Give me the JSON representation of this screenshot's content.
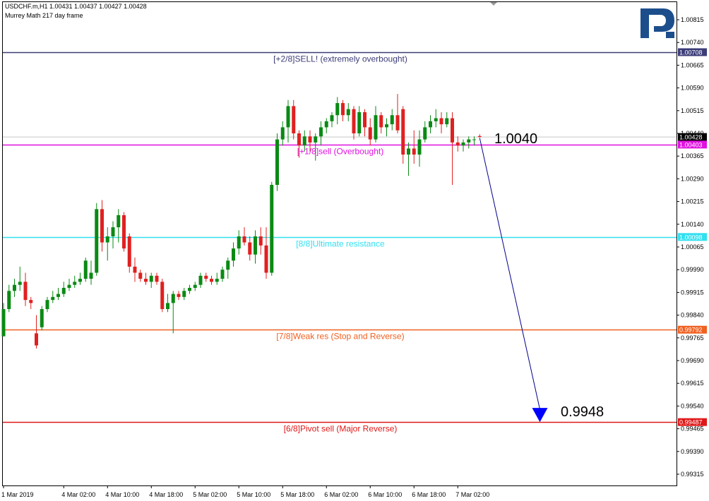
{
  "header": {
    "symbol_line": "USDCHF.m,H1  1.00431 1.00437 1.00427 1.00428",
    "indicator_line": "Murrey Math 217 day frame"
  },
  "logo": {
    "name": "R-logo",
    "color": "#1d4e8c"
  },
  "colors": {
    "up": "#0a8a14",
    "down": "#e02020",
    "arrow": "#00008b",
    "grid": "#000000"
  },
  "chart_data": {
    "type": "candlestick",
    "symbol": "USDCHF.m",
    "timeframe": "H1",
    "ylim": [
      0.9926,
      1.0088
    ],
    "y_ticks": [
      "1.00815",
      "1.00740",
      "1.00665",
      "1.00590",
      "1.00515",
      "1.00440",
      "1.00365",
      "1.00290",
      "1.00215",
      "1.00140",
      "1.00065",
      "0.99990",
      "0.99915",
      "0.99840",
      "0.99765",
      "0.99690",
      "0.99615",
      "0.99540",
      "0.99465",
      "0.99390",
      "0.99315"
    ],
    "x_ticks": [
      {
        "label": "1 Mar 2019",
        "i": 0
      },
      {
        "label": "4 Mar 02:00",
        "i": 11
      },
      {
        "label": "4 Mar 10:00",
        "i": 19
      },
      {
        "label": "4 Mar 18:00",
        "i": 27
      },
      {
        "label": "5 Mar 02:00",
        "i": 35
      },
      {
        "label": "5 Mar 10:00",
        "i": 43
      },
      {
        "label": "5 Mar 18:00",
        "i": 51
      },
      {
        "label": "6 Mar 02:00",
        "i": 59
      },
      {
        "label": "6 Mar 10:00",
        "i": 67
      },
      {
        "label": "6 Mar 18:00",
        "i": 75
      },
      {
        "label": "7 Mar 02:00",
        "i": 83
      }
    ],
    "last_price": {
      "value": 1.00428,
      "label": "1.00428"
    },
    "levels": [
      {
        "name": "[+2/8]SELL! (extremely overbought)",
        "value": 1.00708,
        "label": "1.00708",
        "color": "#3c3c78"
      },
      {
        "name": "[+1/8]sell (Overbought)",
        "value": 1.00403,
        "label": "1.00403",
        "color": "#e010e0"
      },
      {
        "name": "[8/8]Ultimate resistance",
        "value": 1.00098,
        "label": "1.00098",
        "color": "#30e0f0"
      },
      {
        "name": "[7/8]Weak res (Stop and Reverse)",
        "value": 0.99792,
        "label": "0.99792",
        "color": "#f06020"
      },
      {
        "name": "[6/8]Pivot sell (Major Reverse)",
        "value": 0.99487,
        "label": "0.99487",
        "color": "#e01818"
      }
    ],
    "annotations": [
      {
        "text": "1.0040"
      },
      {
        "text": "0.9948"
      }
    ],
    "forecast_arrow": {
      "from_i": 87,
      "from_value": 1.00425,
      "to_i": 98,
      "to_value": 0.99487
    },
    "candles": [
      {
        "o": 0.9977,
        "h": 0.9988,
        "l": 0.9977,
        "c": 0.9986
      },
      {
        "o": 0.9986,
        "h": 0.9994,
        "l": 0.9985,
        "c": 0.9992
      },
      {
        "o": 0.9992,
        "h": 0.9996,
        "l": 0.999,
        "c": 0.9994
      },
      {
        "o": 0.9994,
        "h": 1.0,
        "l": 0.9992,
        "c": 0.9995
      },
      {
        "o": 0.9995,
        "h": 0.9998,
        "l": 0.9987,
        "c": 0.9989
      },
      {
        "o": 0.9989,
        "h": 0.999,
        "l": 0.9986,
        "c": 0.9988
      },
      {
        "o": 0.9978,
        "h": 0.9984,
        "l": 0.9973,
        "c": 0.9974
      },
      {
        "o": 0.998,
        "h": 0.9987,
        "l": 0.9979,
        "c": 0.9986
      },
      {
        "o": 0.9986,
        "h": 0.999,
        "l": 0.9985,
        "c": 0.9989
      },
      {
        "o": 0.9989,
        "h": 0.9992,
        "l": 0.9988,
        "c": 0.999
      },
      {
        "o": 0.999,
        "h": 0.9993,
        "l": 0.9989,
        "c": 0.9991
      },
      {
        "o": 0.9991,
        "h": 0.9995,
        "l": 0.999,
        "c": 0.9993
      },
      {
        "o": 0.9993,
        "h": 0.9996,
        "l": 0.9992,
        "c": 0.9994
      },
      {
        "o": 0.9994,
        "h": 0.9997,
        "l": 0.9993,
        "c": 0.9995
      },
      {
        "o": 0.9995,
        "h": 0.9998,
        "l": 0.9994,
        "c": 0.9996
      },
      {
        "o": 0.9996,
        "h": 1.0003,
        "l": 0.9995,
        "c": 1.0002
      },
      {
        "o": 0.9996,
        "h": 1.0002,
        "l": 0.9994,
        "c": 0.9998
      },
      {
        "o": 0.9998,
        "h": 1.0021,
        "l": 0.9997,
        "c": 1.0019
      },
      {
        "o": 1.0019,
        "h": 1.0022,
        "l": 1.0005,
        "c": 1.0008
      },
      {
        "o": 1.0008,
        "h": 1.0013,
        "l": 1.0002,
        "c": 1.001
      },
      {
        "o": 1.001,
        "h": 1.0015,
        "l": 1.0006,
        "c": 1.0013
      },
      {
        "o": 1.0013,
        "h": 1.0019,
        "l": 1.0008,
        "c": 1.0017
      },
      {
        "o": 1.0017,
        "h": 1.0018,
        "l": 1.0005,
        "c": 1.0006
      },
      {
        "o": 1.001,
        "h": 1.0011,
        "l": 0.9998,
        "c": 1.0
      },
      {
        "o": 1.0,
        "h": 1.0003,
        "l": 0.9995,
        "c": 0.9998
      },
      {
        "o": 0.9998,
        "h": 0.9999,
        "l": 0.9995,
        "c": 0.9996
      },
      {
        "o": 0.9996,
        "h": 0.9998,
        "l": 0.9994,
        "c": 0.9995
      },
      {
        "o": 0.9995,
        "h": 0.9998,
        "l": 0.9993,
        "c": 0.9997
      },
      {
        "o": 0.9997,
        "h": 0.9998,
        "l": 0.9994,
        "c": 0.9995
      },
      {
        "o": 0.9995,
        "h": 0.9996,
        "l": 0.9985,
        "c": 0.9986
      },
      {
        "o": 0.9986,
        "h": 0.9991,
        "l": 0.9985,
        "c": 0.9988
      },
      {
        "o": 0.9988,
        "h": 0.9992,
        "l": 0.9978,
        "c": 0.9991
      },
      {
        "o": 0.9991,
        "h": 0.9992,
        "l": 0.9989,
        "c": 0.999
      },
      {
        "o": 0.999,
        "h": 0.9993,
        "l": 0.9989,
        "c": 0.9992
      },
      {
        "o": 0.9992,
        "h": 0.9994,
        "l": 0.9991,
        "c": 0.9993
      },
      {
        "o": 0.9993,
        "h": 0.9995,
        "l": 0.9992,
        "c": 0.9994
      },
      {
        "o": 0.9994,
        "h": 0.9998,
        "l": 0.9993,
        "c": 0.9997
      },
      {
        "o": 0.9997,
        "h": 0.9998,
        "l": 0.9995,
        "c": 0.9996
      },
      {
        "o": 0.9996,
        "h": 0.9997,
        "l": 0.9994,
        "c": 0.9995
      },
      {
        "o": 0.9995,
        "h": 0.9998,
        "l": 0.9994,
        "c": 0.9996
      },
      {
        "o": 0.9996,
        "h": 1.0,
        "l": 0.9995,
        "c": 0.9999
      },
      {
        "o": 0.9999,
        "h": 1.0003,
        "l": 0.9996,
        "c": 1.0002
      },
      {
        "o": 1.0002,
        "h": 1.0008,
        "l": 1.0,
        "c": 1.0006
      },
      {
        "o": 1.0006,
        "h": 1.0012,
        "l": 1.0004,
        "c": 1.001
      },
      {
        "o": 1.001,
        "h": 1.0013,
        "l": 1.0007,
        "c": 1.0008
      },
      {
        "o": 1.0008,
        "h": 1.001,
        "l": 1.0002,
        "c": 1.0004
      },
      {
        "o": 1.0004,
        "h": 1.0012,
        "l": 1.0001,
        "c": 1.001
      },
      {
        "o": 1.001,
        "h": 1.0013,
        "l": 1.0004,
        "c": 1.0007
      },
      {
        "o": 1.0007,
        "h": 1.0013,
        "l": 0.9996,
        "c": 0.9998
      },
      {
        "o": 0.9998,
        "h": 1.0028,
        "l": 0.9997,
        "c": 1.0027
      },
      {
        "o": 1.0027,
        "h": 1.0044,
        "l": 1.0025,
        "c": 1.0042
      },
      {
        "o": 1.0042,
        "h": 1.0048,
        "l": 1.004,
        "c": 1.0046
      },
      {
        "o": 1.0046,
        "h": 1.0055,
        "l": 1.0041,
        "c": 1.0053
      },
      {
        "o": 1.0053,
        "h": 1.0055,
        "l": 1.0042,
        "c": 1.0044
      },
      {
        "o": 1.0044,
        "h": 1.0045,
        "l": 1.0036,
        "c": 1.004
      },
      {
        "o": 1.004,
        "h": 1.0045,
        "l": 1.0038,
        "c": 1.0043
      },
      {
        "o": 1.0043,
        "h": 1.0045,
        "l": 1.0038,
        "c": 1.0041
      },
      {
        "o": 1.0041,
        "h": 1.0044,
        "l": 1.0035,
        "c": 1.0043
      },
      {
        "o": 1.0043,
        "h": 1.0048,
        "l": 1.004,
        "c": 1.0046
      },
      {
        "o": 1.0046,
        "h": 1.0049,
        "l": 1.0044,
        "c": 1.0048
      },
      {
        "o": 1.0048,
        "h": 1.0051,
        "l": 1.0046,
        "c": 1.005
      },
      {
        "o": 1.005,
        "h": 1.0056,
        "l": 1.0047,
        "c": 1.0054
      },
      {
        "o": 1.0054,
        "h": 1.0055,
        "l": 1.0048,
        "c": 1.005
      },
      {
        "o": 1.005,
        "h": 1.0054,
        "l": 1.0048,
        "c": 1.0052
      },
      {
        "o": 1.0052,
        "h": 1.0053,
        "l": 1.0042,
        "c": 1.0044
      },
      {
        "o": 1.0044,
        "h": 1.0053,
        "l": 1.0043,
        "c": 1.0051
      },
      {
        "o": 1.0051,
        "h": 1.0052,
        "l": 1.0043,
        "c": 1.0046
      },
      {
        "o": 1.0046,
        "h": 1.0049,
        "l": 1.004,
        "c": 1.0042
      },
      {
        "o": 1.0042,
        "h": 1.0053,
        "l": 1.0041,
        "c": 1.005
      },
      {
        "o": 1.005,
        "h": 1.0051,
        "l": 1.0044,
        "c": 1.0046
      },
      {
        "o": 1.0046,
        "h": 1.0049,
        "l": 1.0043,
        "c": 1.0047
      },
      {
        "o": 1.0047,
        "h": 1.0052,
        "l": 1.0045,
        "c": 1.005
      },
      {
        "o": 1.005,
        "h": 1.0057,
        "l": 1.0044,
        "c": 1.0045
      },
      {
        "o": 1.0052,
        "h": 1.0053,
        "l": 1.0034,
        "c": 1.0037
      },
      {
        "o": 1.0037,
        "h": 1.0041,
        "l": 1.003,
        "c": 1.0039
      },
      {
        "o": 1.0039,
        "h": 1.0045,
        "l": 1.0034,
        "c": 1.0037
      },
      {
        "o": 1.0037,
        "h": 1.0045,
        "l": 1.0033,
        "c": 1.0042
      },
      {
        "o": 1.0042,
        "h": 1.0048,
        "l": 1.0041,
        "c": 1.0046
      },
      {
        "o": 1.0046,
        "h": 1.005,
        "l": 1.0044,
        "c": 1.0048
      },
      {
        "o": 1.0048,
        "h": 1.0052,
        "l": 1.0046,
        "c": 1.0049
      },
      {
        "o": 1.0049,
        "h": 1.0051,
        "l": 1.0044,
        "c": 1.0047
      },
      {
        "o": 1.0047,
        "h": 1.0051,
        "l": 1.0046,
        "c": 1.0049
      },
      {
        "o": 1.0049,
        "h": 1.0051,
        "l": 1.0027,
        "c": 1.0041
      },
      {
        "o": 1.0041,
        "h": 1.0043,
        "l": 1.0038,
        "c": 1.004
      },
      {
        "o": 1.004,
        "h": 1.0042,
        "l": 1.0038,
        "c": 1.0041
      },
      {
        "o": 1.0041,
        "h": 1.0043,
        "l": 1.0039,
        "c": 1.0042
      },
      {
        "o": 1.0042,
        "h": 1.0043,
        "l": 1.004,
        "c": 1.0042
      },
      {
        "o": 1.00431,
        "h": 1.00437,
        "l": 1.00427,
        "c": 1.00428
      }
    ]
  }
}
